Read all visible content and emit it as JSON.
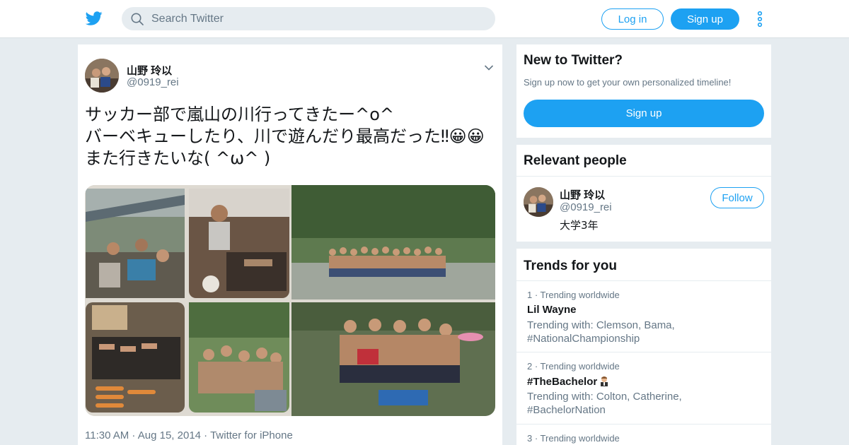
{
  "header": {
    "search_placeholder": "Search Twitter",
    "login_label": "Log in",
    "signup_label": "Sign up",
    "icons": [
      "twitter-bird-icon",
      "search-icon",
      "more-vertical-icon"
    ]
  },
  "tweet": {
    "author_name": "山野 玲以",
    "author_handle": "@0919_rei",
    "text": "サッカー部で嵐山の川行ってきたー^o^\nバーベキューしたり、川で遊んだり最高だった‼😀😀\nまた行きたいな( ^ω^ )",
    "timestamp": "11:30 AM · Aug 15, 2014 · Twitter for iPhone",
    "photos": [
      "bbq-group-photo",
      "grilling-photo",
      "river-group-photo",
      "grill-food-photo",
      "riverside-group-photo",
      "river-posing-photo"
    ]
  },
  "new_to_twitter": {
    "title": "New to Twitter?",
    "subtitle": "Sign up now to get your own personalized timeline!",
    "button_label": "Sign up"
  },
  "relevant_people": {
    "title": "Relevant people",
    "name": "山野 玲以",
    "handle": "@0919_rei",
    "bio": "大学3年",
    "follow_label": "Follow"
  },
  "trends": {
    "title": "Trends for you",
    "items": [
      {
        "context": "1 · Trending worldwide",
        "name": "Lil Wayne",
        "trending_with": "Trending with: Clemson, Bama, #NationalChampionship"
      },
      {
        "context": "2 · Trending worldwide",
        "name": "#TheBachelor",
        "trending_with": "Trending with: Colton, Catherine, #BachelorNation"
      },
      {
        "context": "3 · Trending worldwide",
        "name": "",
        "trending_with": ""
      }
    ]
  },
  "colors": {
    "accent": "#1da1f2",
    "background": "#e6ecf0",
    "secondary_text": "#657786"
  }
}
